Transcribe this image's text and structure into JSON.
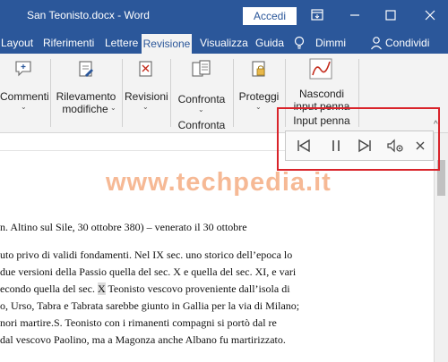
{
  "titlebar": {
    "title": "San Teonisto.docx - Word",
    "signin_label": "Accedi"
  },
  "tabs": [
    "Layout",
    "Riferimenti",
    "Lettere",
    "Revisione",
    "Visualizza",
    "Guida"
  ],
  "tell_me": "Dimmi",
  "share": "Condividi",
  "ribbon": {
    "commenti": "Commenti",
    "rilevamento_1": "Rilevamento",
    "rilevamento_2": "modifiche",
    "revisioni": "Revisioni",
    "confronta": "Confronta",
    "confronta_group": "Confronta",
    "proteggi": "Proteggi",
    "nascondi_1": "Nascondi",
    "nascondi_2": "input penna",
    "input_penna_group": "Input penna"
  },
  "watermark": "www.techpedia.it",
  "document": {
    "lines": [
      "n. Altino sul Sile, 30 ottobre 380) – venerato il 30 ottobre",
      "uto privo di validi fondamenti. Nel IX sec. uno storico dell’epoca lo",
      "due versioni della Passio quella del sec. X e quella del sec. XI, e vari",
      "econdo quella del sec.",
      "X",
      "Teonisto vescovo proveniente dall’isola di",
      "o, Urso, Tabra e Tabrata sarebbe giunto in Gallia per la via di Milano;",
      "nori martire.S. Teonisto con i rimanenti compagni si portò dal re",
      "dal vescovo Paolino, ma a Magonza anche Albano fu martirizzato."
    ]
  },
  "colors": {
    "accent": "#2b579a",
    "ribbon_bg": "#f3f3f3",
    "annotation": "#d9232a",
    "watermark": "#f08040"
  },
  "icons": {
    "window": [
      "ribbon-display-icon",
      "minimize-icon",
      "maximize-icon",
      "close-icon"
    ],
    "media": [
      "previous-icon",
      "pause-icon",
      "next-icon",
      "settings-speaker-icon",
      "close-icon"
    ]
  }
}
